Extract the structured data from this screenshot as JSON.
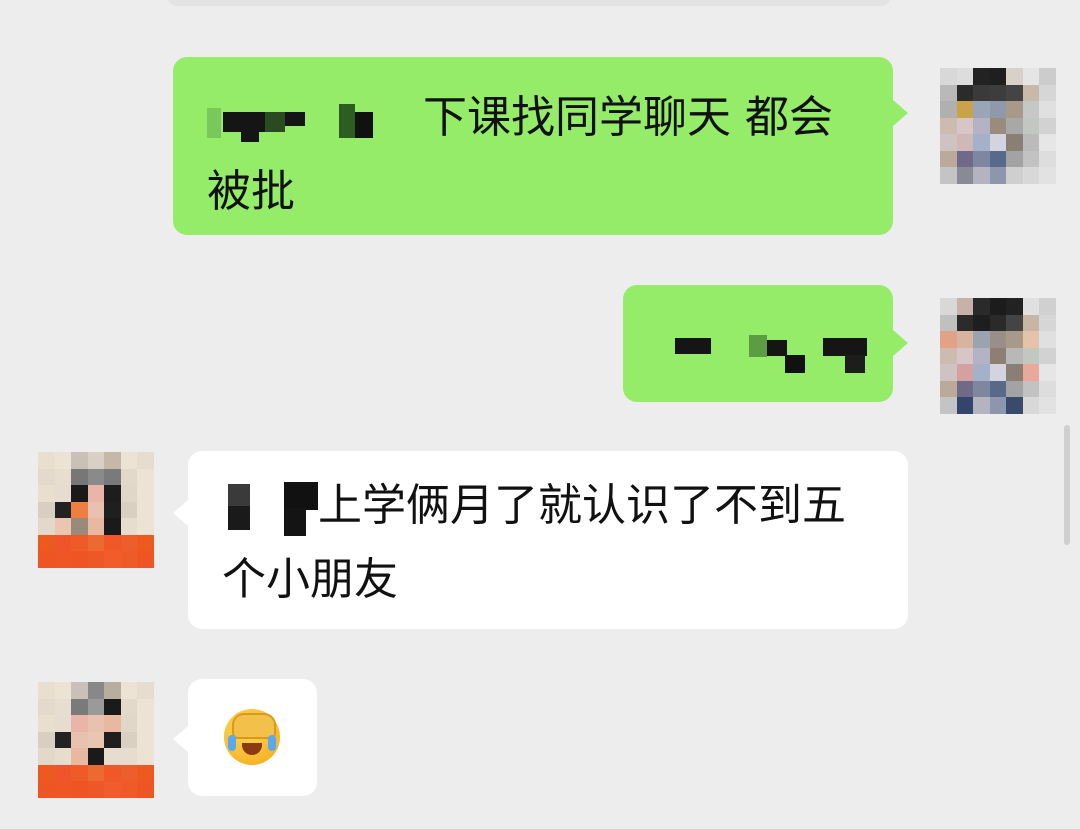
{
  "conversation": {
    "messages": [
      {
        "sender": "self",
        "text": "下课找同学聊天 都会被批"
      },
      {
        "sender": "self",
        "text": ""
      },
      {
        "sender": "other",
        "text": "上学俩月了就认识了不到五个小朋友"
      },
      {
        "sender": "other",
        "emoji": "facepalm-crying-emoji"
      }
    ]
  },
  "colors": {
    "background": "#ededed",
    "self_bubble": "#95ec69",
    "other_bubble": "#ffffff",
    "redaction": "#111111"
  }
}
